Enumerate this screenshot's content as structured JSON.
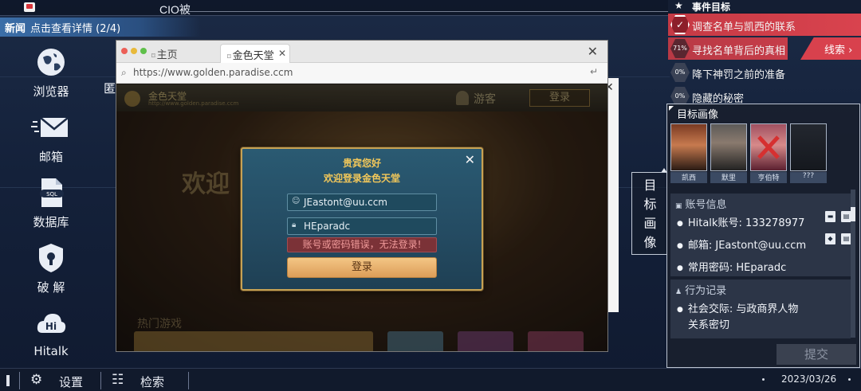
{
  "window": {
    "title": "CIO被"
  },
  "news": {
    "tag": "新闻",
    "text": "点击查看详情 (2/4)"
  },
  "desktop": {
    "icons": [
      {
        "label": "浏览器",
        "icon": "globe-icon"
      },
      {
        "label": "邮箱",
        "icon": "mail-icon"
      },
      {
        "label": "数据库",
        "icon": "sql-file-icon"
      },
      {
        "label": "破 解",
        "icon": "shield-lock-icon"
      },
      {
        "label": "Hitalk",
        "icon": "hitalk-cloud-icon"
      }
    ],
    "partial_label": "匿"
  },
  "browser": {
    "tabs": [
      {
        "label": "主页",
        "active": false
      },
      {
        "label": "金色天堂",
        "active": true
      }
    ],
    "url": "https://www.golden.paradise.ccm",
    "site": {
      "name": "金色天堂",
      "subtitle": "http://www.golden.paradise.ccm",
      "guest_label": "游客",
      "login_label": "登录",
      "welcome": "欢迎",
      "hot_games": "热门游戏"
    },
    "dialog": {
      "title_line1": "贵宾您好",
      "title_line2": "欢迎登录金色天堂",
      "account_value": "JEastont@uu.ccm",
      "password_value": "HEparadc",
      "error": "账号或密码错误，无法登录!",
      "login_button": "登录"
    }
  },
  "goals": {
    "title": "事件目标",
    "items": [
      {
        "badge": "✓",
        "text": "调查名单与凯西的联系",
        "state": "done"
      },
      {
        "badge": "71%",
        "text": "寻找名单背后的真相",
        "state": "active"
      },
      {
        "badge": "0%",
        "text": "降下神罚之前的准备",
        "state": "pending"
      },
      {
        "badge": "0%",
        "text": "隐藏的秘密",
        "state": "pending"
      }
    ],
    "clue_label": "线索"
  },
  "target": {
    "title": "目标画像",
    "vertical_tab": [
      "目",
      "标",
      "画",
      "像"
    ],
    "portraits": [
      {
        "name": "凯西"
      },
      {
        "name": "默里"
      },
      {
        "name": "亨伯特"
      },
      {
        "name": "???"
      }
    ],
    "account_section": {
      "title": "账号信息",
      "rows": [
        "Hitalk账号: 133278977",
        "邮箱: JEastont@uu.ccm",
        "常用密码: HEparadc"
      ]
    },
    "behavior_section": {
      "title": "行为记录",
      "rows": [
        "社会交际: 与政商界人物",
        "关系密切"
      ]
    },
    "submit_label": "提交"
  },
  "taskbar": {
    "settings_label": "设置",
    "search_label": "检索",
    "date": "2023/03/26"
  },
  "colors": {
    "goal_done": "#c53a45",
    "goal_active": "#b83945",
    "dialog_border": "#c7a254",
    "error_text": "#f09a9a"
  }
}
